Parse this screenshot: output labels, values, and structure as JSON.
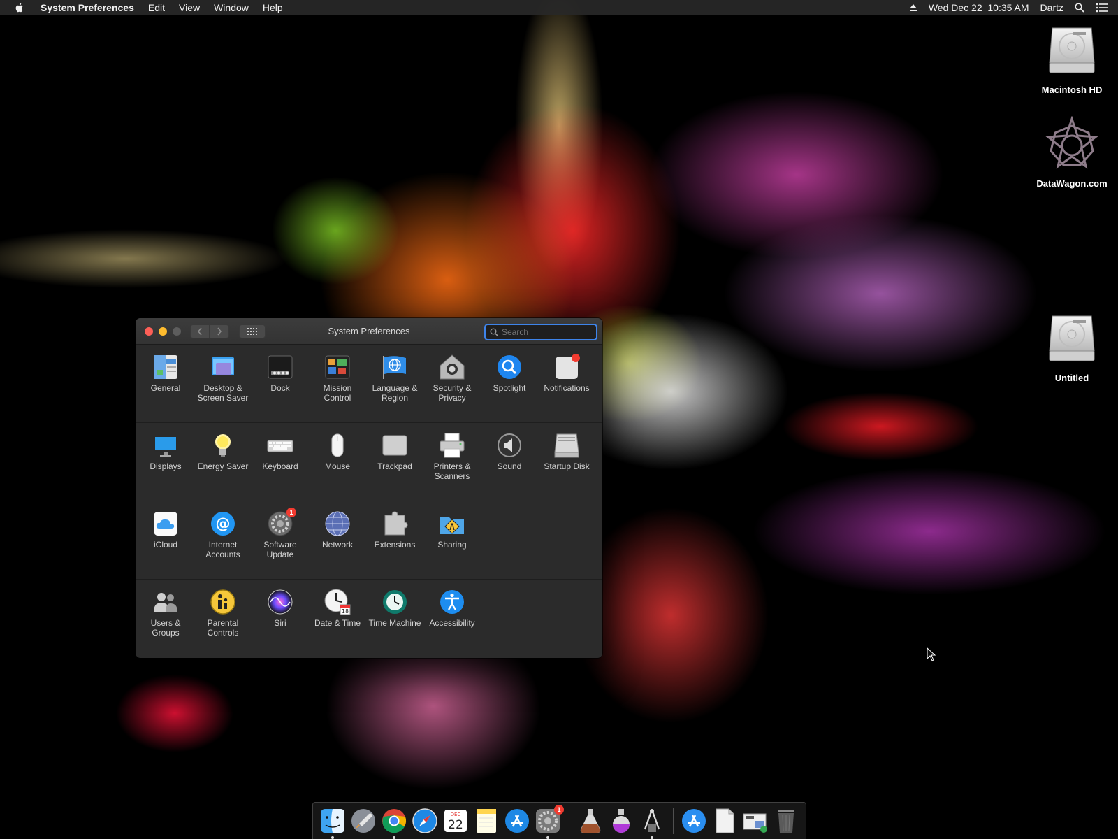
{
  "menubar": {
    "app_name": "System Preferences",
    "menus": [
      "Edit",
      "View",
      "Window",
      "Help"
    ],
    "datetime": "Wed Dec 22  10:35 AM",
    "user": "Dartz"
  },
  "desktop": {
    "icons": [
      {
        "label": "Macintosh HD",
        "icon": "hard-drive-icon"
      },
      {
        "label": "DataWagon.com",
        "icon": "star-logo-icon"
      },
      {
        "label": "Untitled",
        "icon": "hard-drive-icon"
      }
    ]
  },
  "window": {
    "title": "System Preferences",
    "search_placeholder": "Search",
    "rows": [
      [
        {
          "label": "General",
          "icon": "general-icon"
        },
        {
          "label": "Desktop & Screen Saver",
          "icon": "desktop-screensaver-icon"
        },
        {
          "label": "Dock",
          "icon": "dock-icon"
        },
        {
          "label": "Mission Control",
          "icon": "mission-control-icon"
        },
        {
          "label": "Language & Region",
          "icon": "language-region-icon"
        },
        {
          "label": "Security & Privacy",
          "icon": "security-privacy-icon"
        },
        {
          "label": "Spotlight",
          "icon": "spotlight-icon"
        },
        {
          "label": "Notifications",
          "icon": "notifications-icon"
        }
      ],
      [
        {
          "label": "Displays",
          "icon": "displays-icon"
        },
        {
          "label": "Energy Saver",
          "icon": "energy-saver-icon"
        },
        {
          "label": "Keyboard",
          "icon": "keyboard-icon"
        },
        {
          "label": "Mouse",
          "icon": "mouse-icon"
        },
        {
          "label": "Trackpad",
          "icon": "trackpad-icon"
        },
        {
          "label": "Printers & Scanners",
          "icon": "printers-scanners-icon"
        },
        {
          "label": "Sound",
          "icon": "sound-icon"
        },
        {
          "label": "Startup Disk",
          "icon": "startup-disk-icon"
        }
      ],
      [
        {
          "label": "iCloud",
          "icon": "icloud-icon"
        },
        {
          "label": "Internet Accounts",
          "icon": "internet-accounts-icon"
        },
        {
          "label": "Software Update",
          "icon": "software-update-icon",
          "badge": "1"
        },
        {
          "label": "Network",
          "icon": "network-icon"
        },
        {
          "label": "Extensions",
          "icon": "extensions-icon"
        },
        {
          "label": "Sharing",
          "icon": "sharing-icon"
        }
      ],
      [
        {
          "label": "Users & Groups",
          "icon": "users-groups-icon"
        },
        {
          "label": "Parental Controls",
          "icon": "parental-controls-icon"
        },
        {
          "label": "Siri",
          "icon": "siri-icon"
        },
        {
          "label": "Date & Time",
          "icon": "date-time-icon"
        },
        {
          "label": "Time Machine",
          "icon": "time-machine-icon"
        },
        {
          "label": "Accessibility",
          "icon": "accessibility-icon"
        }
      ]
    ],
    "calendar_icon_day": "18"
  },
  "dock": {
    "items": [
      {
        "icon": "finder-icon",
        "running": true
      },
      {
        "icon": "launchpad-icon",
        "running": false
      },
      {
        "icon": "chrome-icon",
        "running": true
      },
      {
        "icon": "safari-icon",
        "running": false
      },
      {
        "icon": "calendar-icon",
        "month": "DEC",
        "day": "22"
      },
      {
        "icon": "notes-icon"
      },
      {
        "icon": "app-store-icon"
      },
      {
        "icon": "system-preferences-icon",
        "running": true,
        "badge": "1"
      },
      {
        "icon": "separator"
      },
      {
        "icon": "potion-brown-icon"
      },
      {
        "icon": "potion-purple-icon"
      },
      {
        "icon": "utility-tool-icon",
        "running": true
      },
      {
        "icon": "separator"
      },
      {
        "icon": "applications-folder-icon"
      },
      {
        "icon": "document-icon"
      },
      {
        "icon": "screenshots-stack-icon"
      },
      {
        "icon": "trash-icon"
      }
    ]
  },
  "colors": {
    "accent": "#3e84ea",
    "close": "#fd5f57",
    "minimize": "#febc2e",
    "badge": "#f23b30"
  }
}
